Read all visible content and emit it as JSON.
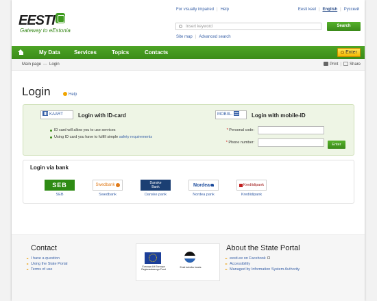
{
  "header": {
    "logo_text": "EESTI",
    "tagline": "Gateway to eEstonia",
    "visually_impaired": "For visually impaired",
    "help": "Help",
    "languages": [
      "Eesti keel",
      "English",
      "Русский"
    ],
    "active_language": "English",
    "search_placeholder": "Insert keyword",
    "search_button": "Search",
    "sitemap": "Site map",
    "advanced_search": "Advanced search"
  },
  "nav": {
    "items": [
      "My Data",
      "Services",
      "Topics",
      "Contacts"
    ],
    "enter": "Enter"
  },
  "breadcrumb": {
    "home": "Main page",
    "separator": "—",
    "current": "Login"
  },
  "tools": {
    "print": "Print",
    "share": "Share"
  },
  "page": {
    "title": "Login",
    "help": "Help"
  },
  "id_card": {
    "badge": "KAART",
    "title": "Login with ID-card",
    "bullet1": "ID card will allow you to use services",
    "bullet2_prefix": "Using ID card you have to fulfill simple",
    "bullet2_link": "safety requirements"
  },
  "mobile_id": {
    "badge": "MOBIIL-",
    "title": "Login with mobile-ID",
    "personal_code_label": "Personal code:",
    "phone_label": "Phone number:",
    "required_mark": "*",
    "enter_button": "Enter"
  },
  "banks": {
    "title": "Login via bank",
    "items": [
      {
        "logo": "SEB",
        "name": "SEB"
      },
      {
        "logo": "Swedbank",
        "name": "Swedbank"
      },
      {
        "logo_line1": "Danske",
        "logo_line2": "Bank",
        "name": "Danske pank"
      },
      {
        "logo": "Nordea",
        "name": "Nordea pank"
      },
      {
        "logo": "Krediidipank",
        "name": "Krediidipank"
      }
    ]
  },
  "footer": {
    "contact_title": "Contact",
    "contact_links": [
      "I have a question",
      "Using the State Portal",
      "Terms of use"
    ],
    "eu_caption": "Euroopa Liit Euroopa Regionaalarengu Fond",
    "est_caption": "Eesti tuleviku heaks",
    "about_title": "About the State Portal",
    "about_links": [
      "eesti.ee on Facebook",
      "Accessibility",
      "Managed by Information System Authority"
    ]
  }
}
